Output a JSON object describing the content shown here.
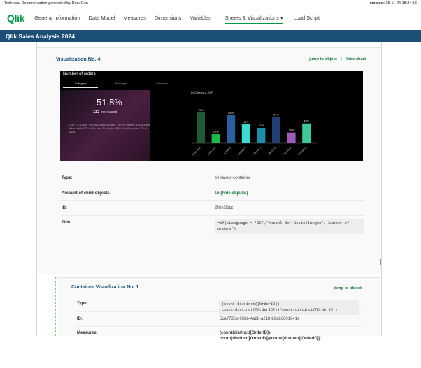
{
  "top": {
    "generated": "Technical Documentation generated by DocuGen",
    "created_label": "created:",
    "created_value": "25-11-24 18:34:56"
  },
  "nav": {
    "logo": "Qlik",
    "items": [
      "General Information",
      "Data Model",
      "Measures",
      "Dimensions",
      "Variables",
      "Sheets & Visualizations ▾",
      "Load Script"
    ],
    "active_index": 5
  },
  "app_title": "Qlik Sales Analysis 2024",
  "viz": {
    "title": "Visualization No. 4",
    "jump_link": "jump to object",
    "separator": "|",
    "hide_link": "hide chart",
    "preview": {
      "title": "Number of orders",
      "tabs": [
        "Category",
        "Employee",
        "Customer"
      ],
      "kpi_value": "51,8%",
      "kpi_count": "132",
      "kpi_suffix": "increased",
      "description": "A to P1 is 51.8%. The total Sales is 1,58M. The top OrderID is 10981 with Sales that is 2,7% of the total. The bottom 254 OrderID produce 5% of Sales.",
      "bar_caption": "by Category - WP"
    },
    "type_label": "Type:",
    "type_value": "sn-layout-container",
    "children_label": "Amount of child-objects:",
    "children_value": "16",
    "children_link": "(hide objects)",
    "id_label": "ID:",
    "id_value": "ZKm2Dzz",
    "title_label": "Title:",
    "title_code_1": "=if(vLanguage = 'DE','Anzahl der Bestellungen','Number of",
    "title_code_2": "orders')"
  },
  "container": {
    "title": "Container Visualization No. 1",
    "jump_link": "jump to object",
    "type_label": "Type:",
    "type_value": "kpi",
    "id_label": "ID:",
    "id_value": "5ca7735b-956b-4a28-a218-b9ab3801641e",
    "measures_label": "Measures:",
    "measures_bold_1": "(count(distinct([OrderID])-",
    "measures_bold_2": "count(distinct([OrderID]))/count(distinct([OrderID]):",
    "measures_code_1": "(count(distinct([OrderID])-",
    "measures_code_2": "count(distinct([OrderID]))/count(distinct([OrderID])"
  },
  "chart_data": {
    "type": "bar",
    "categories": [
      "Baby ele...",
      "Bath Clo...",
      "Childre...",
      "Ladies F...",
      "Men's C...",
      "Men's S...",
      "Sportsw...",
      "Womens..."
    ],
    "values": [
      75,
      22,
      68,
      46,
      37,
      64,
      26,
      48
    ],
    "labels": [
      "75%",
      "22%",
      "68%",
      "46%",
      "37%",
      "64%",
      "26%",
      "48%"
    ],
    "colors": [
      "#1e5a32",
      "#1cb84a",
      "#2a5f9e",
      "#3bdbd0",
      "#1b8faa",
      "#223f75",
      "#a05ab8",
      "#3cc9a0"
    ],
    "ylim": [
      0,
      100
    ]
  }
}
